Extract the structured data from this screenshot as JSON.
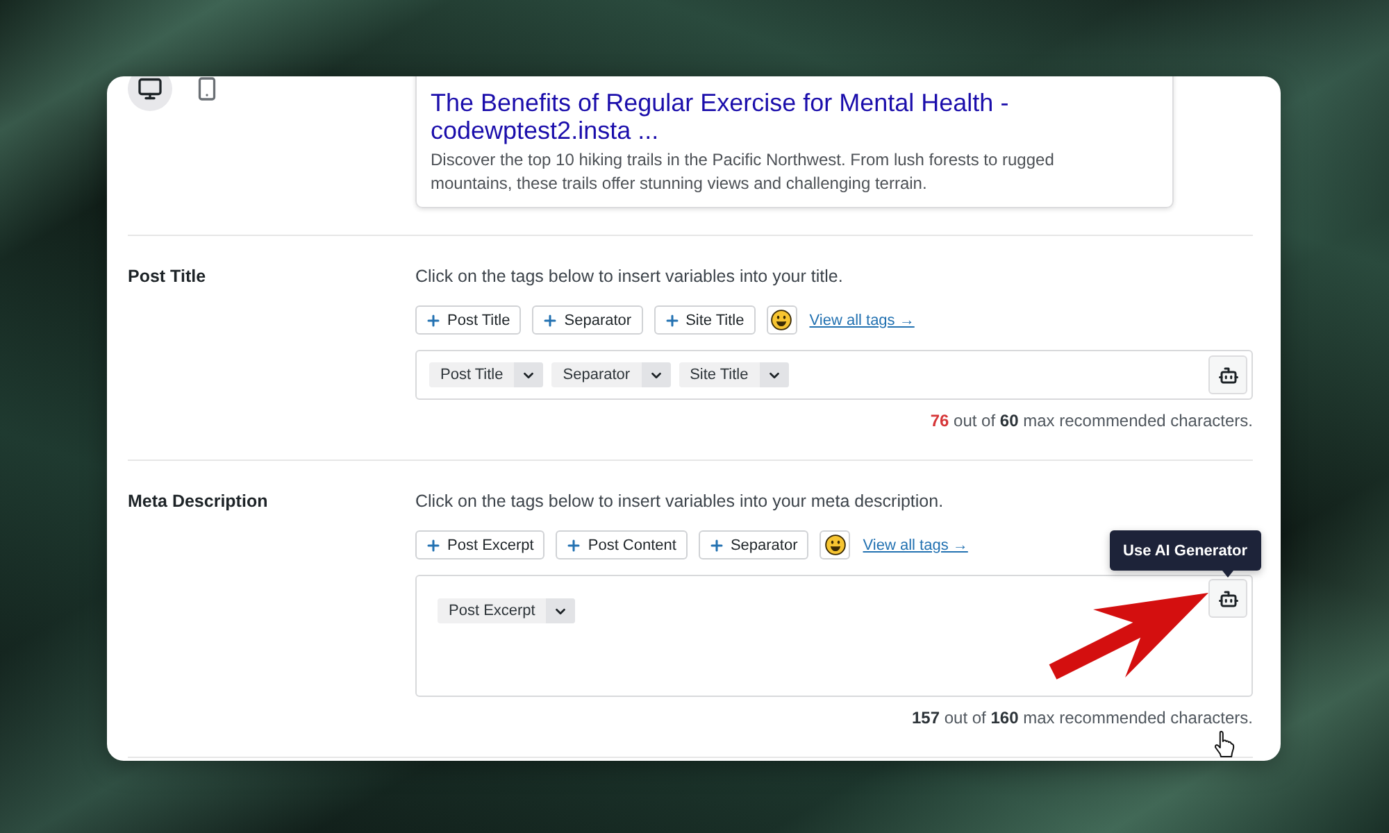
{
  "preview": {
    "devices": [
      {
        "kind": "desktop",
        "selected": true
      },
      {
        "kind": "mobile",
        "selected": false
      }
    ],
    "title": "The Benefits of Regular Exercise for Mental Health - codewptest2.insta ...",
    "description": "Discover the top 10 hiking trails in the Pacific Northwest. From lush forests to rugged mountains, these trails offer stunning views and challenging terrain."
  },
  "sections": [
    {
      "label": "Post Title",
      "hint": "Click on the tags below to insert variables into your title.",
      "tag_buttons": [
        "Post Title",
        "Separator",
        "Site Title"
      ],
      "view_all_link": "View all tags →",
      "field": {
        "multiline": false,
        "chips": [
          "Post Title",
          "Separator",
          "Site Title"
        ]
      },
      "counter": {
        "count": "76",
        "over_limit": true,
        "middle": "out of",
        "max": "60",
        "tail": "max recommended characters."
      }
    },
    {
      "label": "Meta Description",
      "hint": "Click on the tags below to insert variables into your meta description.",
      "tag_buttons": [
        "Post Excerpt",
        "Post Content",
        "Separator"
      ],
      "view_all_link": "View all tags →",
      "field": {
        "multiline": true,
        "chips": [
          "Post Excerpt"
        ],
        "ai_tooltip": "Use AI Generator"
      },
      "counter": {
        "count": "157",
        "over_limit": false,
        "middle": "out of",
        "max": "160",
        "tail": "max recommended characters."
      }
    }
  ]
}
